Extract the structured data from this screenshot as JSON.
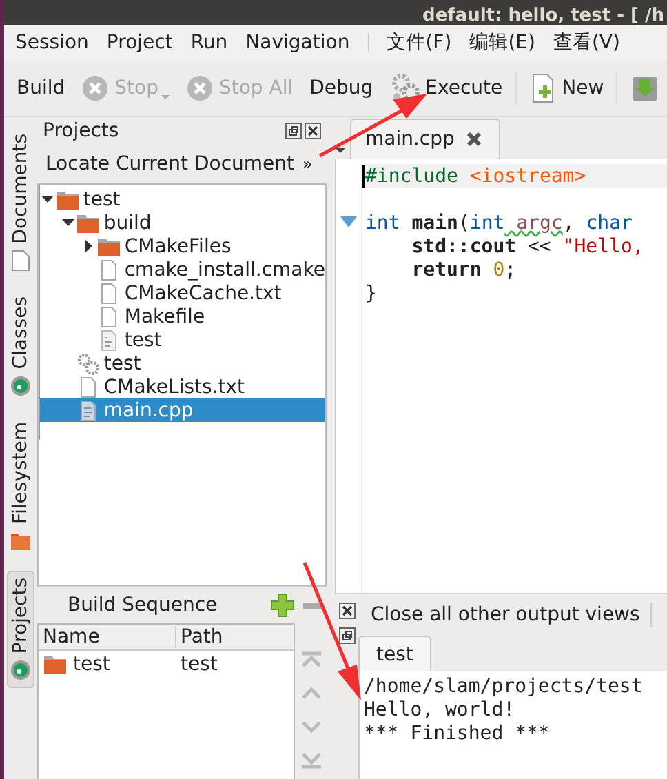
{
  "window": {
    "title": "default:  hello, test - [ /h"
  },
  "menu_groups": [
    [
      {
        "label": "Session"
      },
      {
        "label": "Project"
      },
      {
        "label": "Run"
      },
      {
        "label": "Navigation"
      }
    ],
    [
      {
        "label": "文件(F)"
      },
      {
        "label": "编辑(E)"
      },
      {
        "label": "查看(V)"
      }
    ]
  ],
  "toolbar": [
    {
      "label": "Build",
      "kind": "text",
      "disabled": false
    },
    {
      "label": "Stop",
      "kind": "stop",
      "disabled": true
    },
    {
      "label": "Stop All",
      "kind": "stop",
      "disabled": true
    },
    {
      "label": "Debug",
      "kind": "text",
      "disabled": false
    },
    {
      "label": "Execute",
      "kind": "execute",
      "disabled": false
    },
    {
      "label": "New",
      "kind": "new",
      "disabled": false
    },
    {
      "kind": "save"
    }
  ],
  "side_tabs": [
    {
      "label": "Documents",
      "kind": "document",
      "selected": false
    },
    {
      "label": "Classes",
      "kind": "gear",
      "selected": false
    },
    {
      "label": "Filesystem",
      "kind": "folder",
      "selected": false
    },
    {
      "label": "Projects",
      "kind": "gear",
      "selected": true
    }
  ],
  "projects": {
    "title": "Projects",
    "locate": "Locate Current Document",
    "more": "»",
    "tree": [
      {
        "label": "test",
        "kind": "folder",
        "expanded": true,
        "selected": false,
        "children": [
          {
            "label": "build",
            "kind": "folder",
            "expanded": true,
            "selected": false,
            "children": [
              {
                "label": "CMakeFiles",
                "kind": "folder",
                "expanded": false,
                "selected": false
              },
              {
                "label": "cmake_install.cmake",
                "kind": "file",
                "selected": false
              },
              {
                "label": "CMakeCache.txt",
                "kind": "file",
                "selected": false
              },
              {
                "label": "Makefile",
                "kind": "file",
                "selected": false
              },
              {
                "label": "test",
                "kind": "binary",
                "selected": false
              }
            ]
          },
          {
            "label": "test",
            "kind": "target",
            "selected": false
          },
          {
            "label": "CMakeLists.txt",
            "kind": "file",
            "selected": false
          },
          {
            "label": "main.cpp",
            "kind": "source",
            "selected": true
          }
        ]
      }
    ]
  },
  "build_sequence": {
    "title": "Build Sequence",
    "columns": [
      "Name",
      "Path"
    ],
    "rows": [
      {
        "name": "test",
        "path": "test"
      }
    ]
  },
  "editor": {
    "tabs": [
      {
        "label": "main.cpp",
        "selected": true
      }
    ],
    "lines": [
      {
        "kind": "code",
        "current": true,
        "foldable": false,
        "tokens": [
          {
            "text": "#include",
            "kind": "pre"
          },
          {
            "text": " <iostream>",
            "kind": "inc"
          }
        ]
      },
      {
        "kind": "blank",
        "current": false,
        "foldable": false
      },
      {
        "kind": "code",
        "current": false,
        "foldable": true,
        "tokens": [
          {
            "text": "int",
            "kind": "kw"
          },
          {
            "text": " main",
            "kind": "fn"
          },
          {
            "text": "(",
            "kind": "p"
          },
          {
            "text": "int",
            "kind": "kw"
          },
          {
            "text": " argc",
            "kind": "warn"
          },
          {
            "text": ",",
            "kind": "p"
          },
          {
            "text": " char",
            "kind": "kw"
          }
        ]
      },
      {
        "kind": "code",
        "current": false,
        "foldable": false,
        "tokens": [
          {
            "text": "    std::cout",
            "kind": "fn"
          },
          {
            "text": " <<",
            "kind": "p"
          },
          {
            "text": " \"Hello,",
            "kind": "str"
          }
        ]
      },
      {
        "kind": "code",
        "current": false,
        "foldable": false,
        "tokens": [
          {
            "text": "    return",
            "kind": "fn"
          },
          {
            "text": " 0",
            "kind": "num"
          },
          {
            "text": ";",
            "kind": "p"
          }
        ]
      },
      {
        "kind": "code",
        "current": false,
        "foldable": false,
        "tokens": [
          {
            "text": "}",
            "kind": "p"
          }
        ]
      }
    ]
  },
  "output": {
    "close_others": "Close all other output views",
    "tabs": [
      {
        "label": "test",
        "selected": true
      }
    ],
    "lines": [
      "/home/slam/projects/test",
      "Hello, world!",
      "*** Finished ***"
    ]
  }
}
